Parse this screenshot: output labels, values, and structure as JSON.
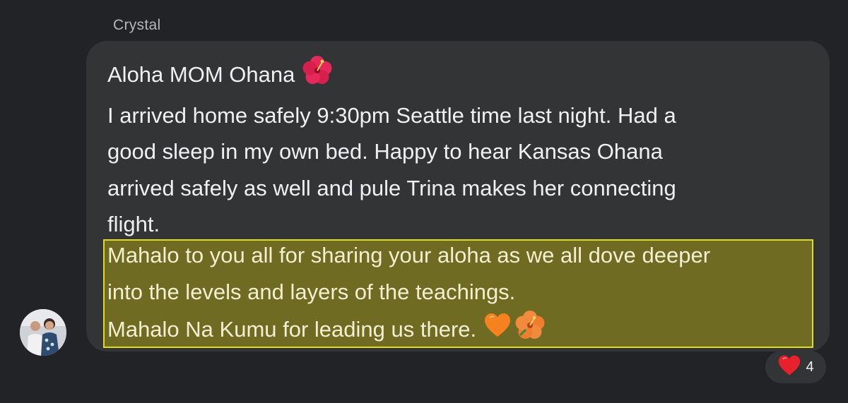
{
  "message": {
    "sender": "Crystal",
    "lines": [
      "Aloha MOM Ohana",
      "I arrived home safely 9:30pm Seattle time last night. Had a",
      "good sleep in my own bed. Happy to hear Kansas Ohana",
      "arrived safely as well and pule Trina makes her connecting",
      "flight."
    ],
    "highlighted_lines": [
      "Mahalo to you all for sharing your aloha as we all dove deeper",
      "into the levels and layers of the teachings.",
      "Mahalo Na Kumu for leading us there."
    ]
  },
  "reaction": {
    "emoji": "heart",
    "count": "4"
  },
  "colors": {
    "background": "#222326",
    "bubble": "#333436",
    "highlight_fill": "#6f6b23",
    "highlight_border": "#e2dc1e",
    "heart": "#e8222c",
    "orange_heart": "#f5811f",
    "hibiscus": "#e6285a"
  }
}
